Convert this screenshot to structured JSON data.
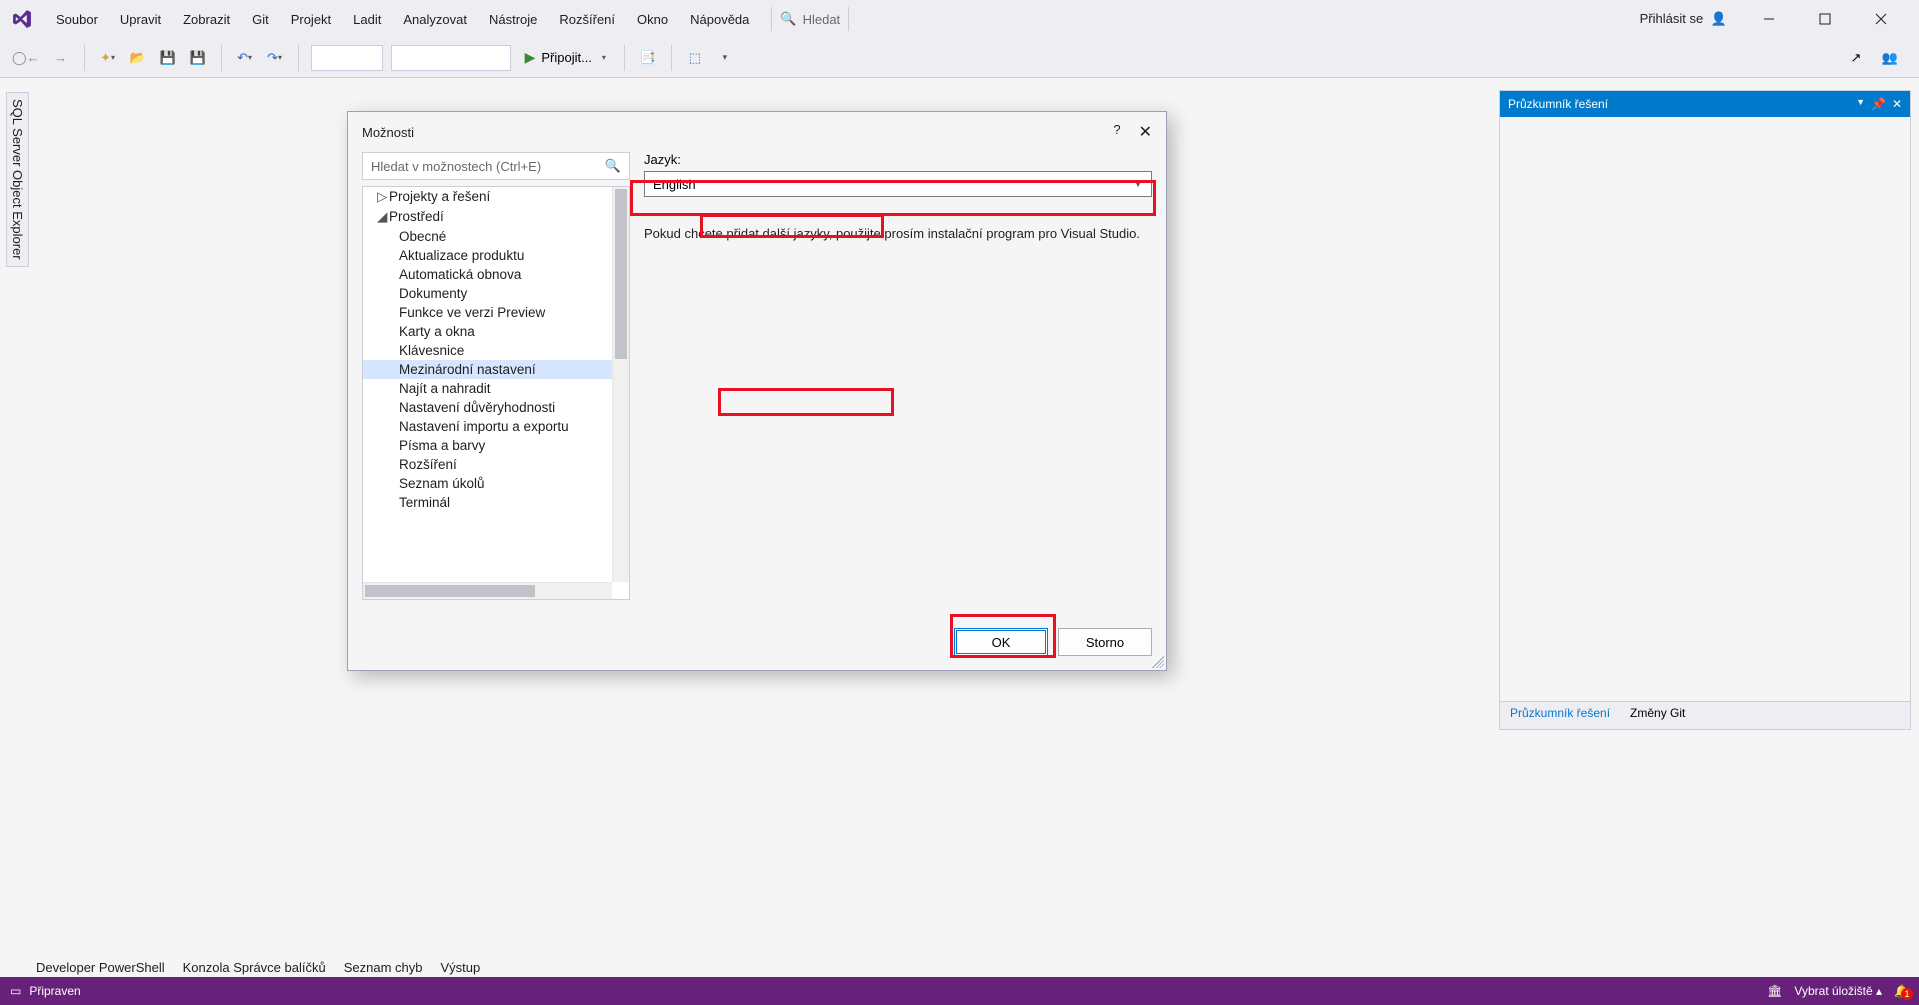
{
  "menubar": {
    "items": [
      "Soubor",
      "Upravit",
      "Zobrazit",
      "Git",
      "Projekt",
      "Ladit",
      "Analyzovat",
      "Nástroje",
      "Rozšíření",
      "Okno",
      "Nápověda"
    ],
    "search_placeholder": "Hledat",
    "signin": "Přihlásit se"
  },
  "toolbar": {
    "attach_label": "Připojit..."
  },
  "side_tab": "SQL Server Object Explorer",
  "solution_explorer": {
    "title": "Průzkumník řešení",
    "tab_active": "Průzkumník řešení",
    "tab_git": "Změny Git"
  },
  "bottom_tabs": [
    "Developer PowerShell",
    "Konzola Správce balíčků",
    "Seznam chyb",
    "Výstup"
  ],
  "statusbar": {
    "ready": "Připraven",
    "repo": "Vybrat úložiště",
    "notif_count": "1"
  },
  "dialog": {
    "title": "Možnosti",
    "search_placeholder": "Hledat v možnostech (Ctrl+E)",
    "tree": {
      "top": "Projekty a řešení",
      "env": "Prostředí",
      "children": [
        "Obecné",
        "Aktualizace produktu",
        "Automatická obnova",
        "Dokumenty",
        "Funkce ve verzi Preview",
        "Karty a okna",
        "Klávesnice",
        "Mezinárodní nastavení",
        "Najít a nahradit",
        "Nastavení důvěryhodnosti",
        "Nastavení importu a exportu",
        "Písma a barvy",
        "Rozšíření",
        "Seznam úkolů",
        "Terminál"
      ]
    },
    "lang_label": "Jazyk:",
    "lang_value": "English",
    "info": "Pokud chcete přidat další jazyky, použijte prosím instalační program pro Visual Studio.",
    "ok": "OK",
    "cancel": "Storno"
  }
}
